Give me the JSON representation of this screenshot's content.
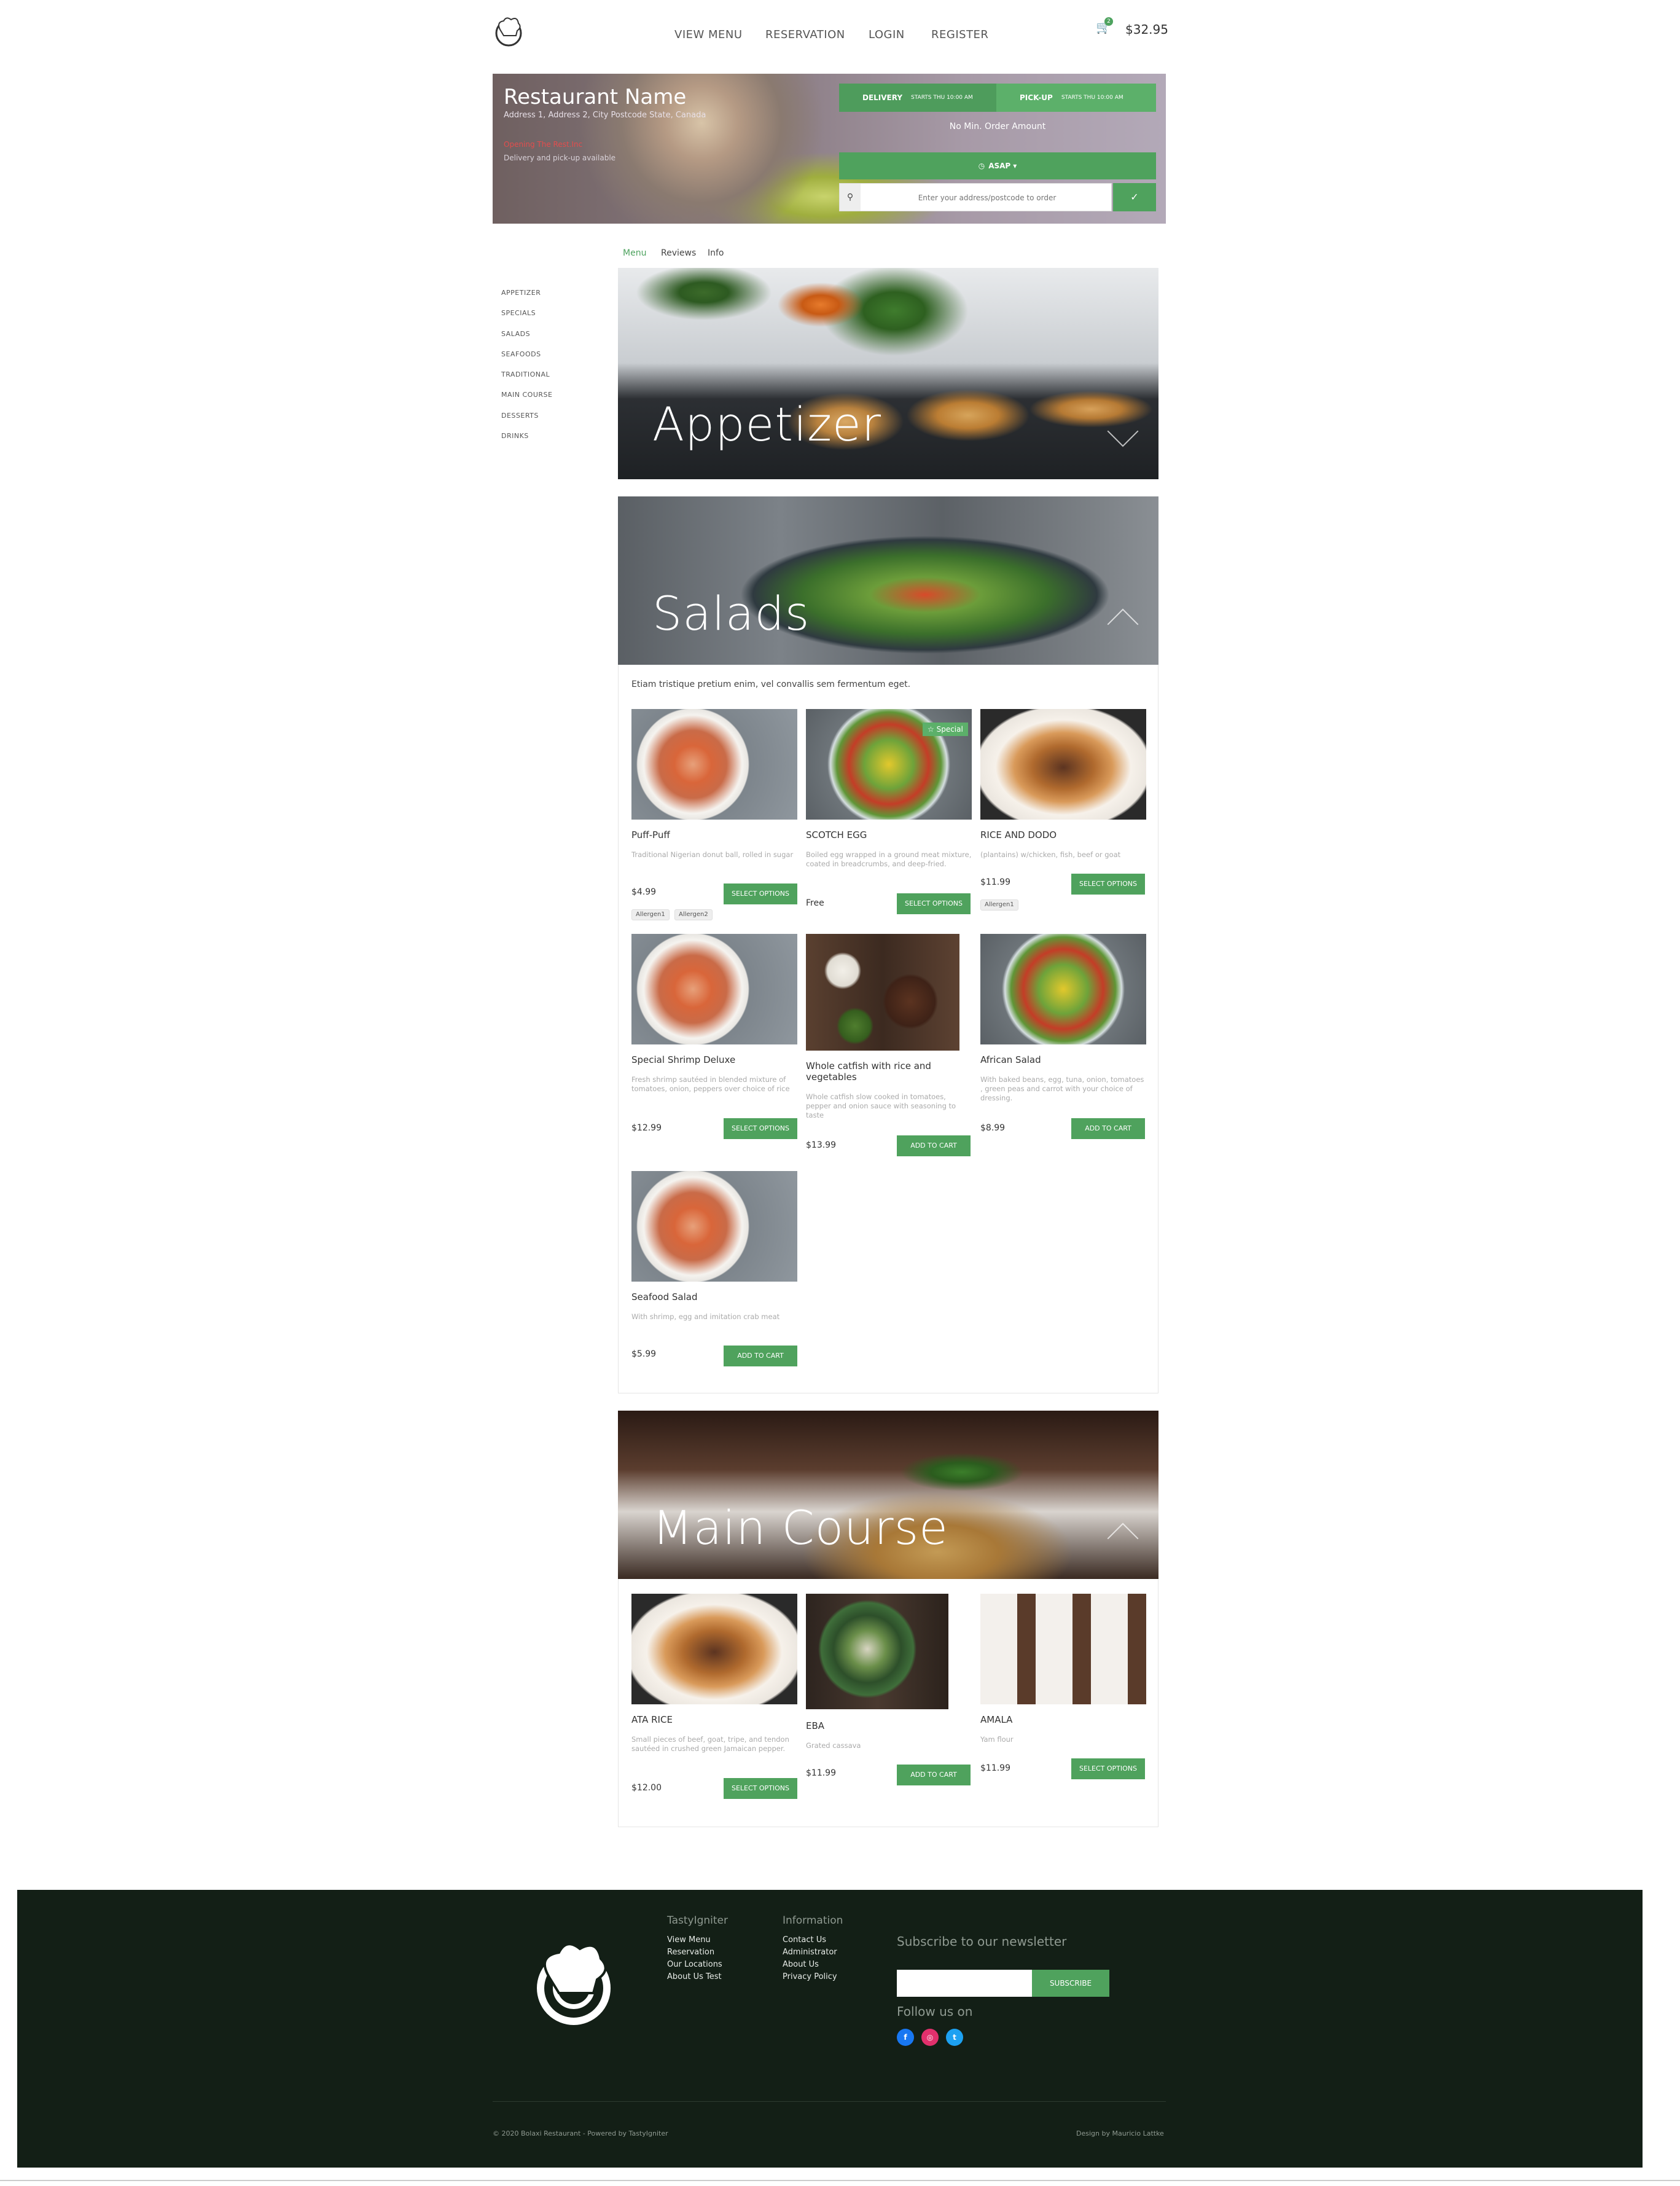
{
  "nav": {
    "items": [
      "VIEW MENU",
      "RESERVATION",
      "LOGIN",
      "REGISTER"
    ],
    "cart_count": "2",
    "cart_total": "$32.95"
  },
  "hero": {
    "restaurant_name": "Restaurant Name",
    "address": "Address 1, Address 2, City Postcode State, Canada",
    "opening_status": "Opening The Rest.Inc",
    "availability": "Delivery and pick-up available",
    "delivery_label": "DELIVERY",
    "delivery_time": "STARTS THU 10:00 AM",
    "pickup_label": "PICK-UP",
    "pickup_time": "STARTS THU 10:00 AM",
    "min_order": "No Min. Order Amount",
    "asap_label": "ASAP",
    "address_placeholder": "Enter your address/postcode to order"
  },
  "menu_tabs": [
    "Menu",
    "Reviews",
    "Info"
  ],
  "categories": [
    "APPETIZER",
    "SPECIALS",
    "SALADS",
    "SEAFOODS",
    "TRADITIONAL",
    "MAIN COURSE",
    "DESSERTS",
    "DRINKS"
  ],
  "banners": {
    "appetizer": "Appetizer",
    "salads": "Salads",
    "main_course": "Main Course"
  },
  "salads": {
    "description": "Etiam tristique pretium enim, vel convallis sem fermentum eget.",
    "items": [
      {
        "name": "Puff-Puff",
        "desc": "Traditional Nigerian donut ball, rolled in sugar",
        "price": "$4.99",
        "button": "SELECT OPTIONS",
        "allergens": [
          "Allergen1",
          "Allergen2"
        ]
      },
      {
        "name": "SCOTCH EGG",
        "desc": "Boiled egg wrapped in a ground meat mixture, coated in breadcrumbs, and deep-fried.",
        "price": "Free",
        "button": "SELECT OPTIONS",
        "tag": "Special"
      },
      {
        "name": "RICE AND DODO",
        "desc": "(plantains) w/chicken, fish, beef or goat",
        "price": "$11.99",
        "button": "SELECT OPTIONS",
        "allergens": [
          "Allergen1"
        ]
      },
      {
        "name": "Special Shrimp Deluxe",
        "desc": "Fresh shrimp sautéed in blended mixture of tomatoes, onion, peppers over choice of rice",
        "price": "$12.99",
        "button": "SELECT OPTIONS"
      },
      {
        "name": "Whole catfish with rice and vegetables",
        "desc": "Whole catfish slow cooked in tomatoes, pepper and onion sauce with seasoning to taste",
        "price": "$13.99",
        "button": "ADD TO CART"
      },
      {
        "name": "African Salad",
        "desc": "With baked beans, egg, tuna, onion, tomatoes , green peas and carrot with your choice of dressing.",
        "price": "$8.99",
        "button": "ADD TO CART"
      },
      {
        "name": "Seafood Salad",
        "desc": "With shrimp, egg and imitation crab meat",
        "price": "$5.99",
        "button": "ADD TO CART"
      }
    ]
  },
  "main_course": {
    "items": [
      {
        "name": "ATA RICE",
        "desc": "Small pieces of beef, goat, tripe, and tendon sautéed in crushed green Jamaican pepper.",
        "price": "$12.00",
        "button": "SELECT OPTIONS"
      },
      {
        "name": "EBA",
        "desc": "Grated cassava",
        "price": "$11.99",
        "button": "ADD TO CART"
      },
      {
        "name": "AMALA",
        "desc": "Yam flour",
        "price": "$11.99",
        "button": "SELECT OPTIONS"
      }
    ]
  },
  "footer": {
    "col1_title": "TastyIgniter",
    "col1_links": [
      "View Menu",
      "Reservation",
      "Our Locations",
      "About Us Test"
    ],
    "col2_title": "Information",
    "col2_links": [
      "Contact Us",
      "Administrator",
      "About Us",
      "Privacy Policy"
    ],
    "newsletter_title": "Subscribe to our newsletter",
    "subscribe_label": "SUBSCRIBE",
    "follow_title": "Follow us on",
    "copyright": "© 2020 Bolaxi Restaurant - Powered by TastyIgniter",
    "design_credit": "Design by Mauricio Lattke",
    "social": [
      {
        "name": "facebook",
        "glyph": "f",
        "color": "#1877f2"
      },
      {
        "name": "instagram",
        "glyph": "◎",
        "color": "#e1306c"
      },
      {
        "name": "twitter",
        "glyph": "t",
        "color": "#1da1f2"
      }
    ]
  },
  "colors": {
    "brand_green": "#4fa25d",
    "footer_bg": "#131f16",
    "open_status_red": "#e34d4d"
  }
}
